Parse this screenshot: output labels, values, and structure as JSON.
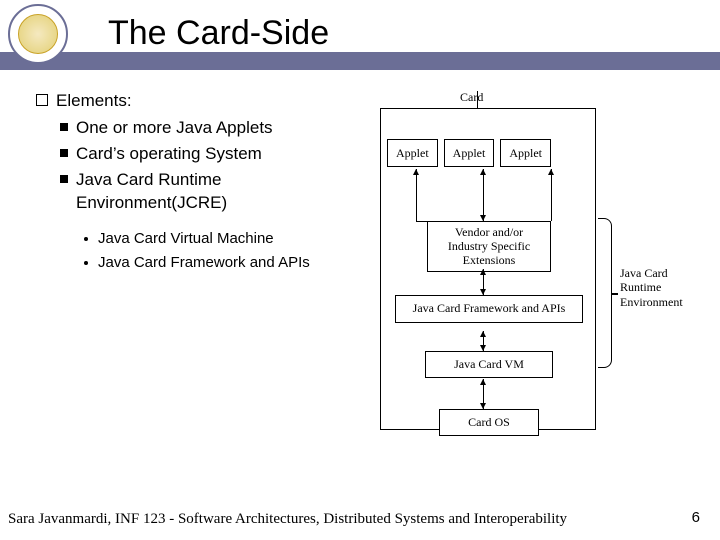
{
  "title": "The Card-Side",
  "outline": {
    "l1": "Elements:",
    "l2a": "One or more Java Applets",
    "l2b": "Card’s operating System",
    "l2c": "Java Card Runtime Environment(JCRE)",
    "l3a": "Java Card Virtual Machine",
    "l3b": "Java Card Framework and APIs"
  },
  "diagram": {
    "card": "Card",
    "applet": "Applet",
    "vendor": "Vendor and/or Industry Specific Extensions",
    "fw": "Java Card Framework and APIs",
    "vm": "Java Card VM",
    "os": "Card OS",
    "jcre": "Java Card Runtime Environment"
  },
  "footer": "Sara Javanmardi, INF 123 - Software Architectures, Distributed Systems and Interoperability",
  "page": "6"
}
